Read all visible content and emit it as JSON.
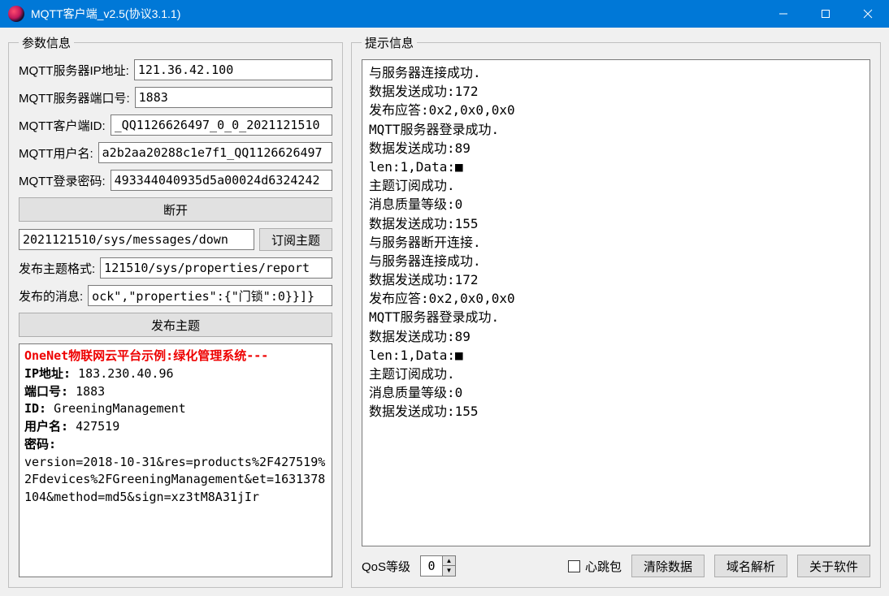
{
  "window": {
    "title": "MQTT客户端_v2.5(协议3.1.1)"
  },
  "left": {
    "legend": "参数信息",
    "server_ip_label": "MQTT服务器IP地址:",
    "server_ip": "121.36.42.100",
    "server_port_label": "MQTT服务器端口号:",
    "server_port": "1883",
    "client_id_label": "MQTT客户端ID:",
    "client_id": "_QQ1126626497_0_0_2021121510",
    "username_label": "MQTT用户名:",
    "username": "a2b2aa20288c1e7f1_QQ1126626497",
    "password_label": "MQTT登录密码:",
    "password": "493344040935d5a00024d6324242",
    "disconnect_btn": "断开",
    "sub_topic": "2021121510/sys/messages/down",
    "sub_btn": "订阅主题",
    "pub_topic_label": "发布主题格式:",
    "pub_topic": "121510/sys/properties/report",
    "pub_msg_label": "发布的消息:",
    "pub_msg": "ock\",\"properties\":{\"门锁\":0}}]}",
    "pub_btn": "发布主题",
    "example": {
      "title": "OneNet物联网云平台示例:绿化管理系统---",
      "ip_label": "IP地址:",
      "ip": "183.230.40.96",
      "port_label": "端口号:",
      "port": "1883",
      "id_label": "ID:",
      "id": "GreeningManagement",
      "user_label": "用户名:",
      "user": "427519",
      "pwd_label": "密码:",
      "pwd_body": "version=2018-10-31&res=products%2F427519%2Fdevices%2FGreeningManagement&et=1631378104&method=md5&sign=xz3tM8A31jIr"
    }
  },
  "right": {
    "legend": "提示信息",
    "log_lines": [
      "与服务器连接成功.",
      "数据发送成功:172",
      "发布应答:0x2,0x0,0x0",
      "MQTT服务器登录成功.",
      "数据发送成功:89",
      "len:1,Data:■",
      "主题订阅成功.",
      "消息质量等级:0",
      "数据发送成功:155",
      "与服务器断开连接.",
      "与服务器连接成功.",
      "数据发送成功:172",
      "发布应答:0x2,0x0,0x0",
      "MQTT服务器登录成功.",
      "数据发送成功:89",
      "len:1,Data:■",
      "主题订阅成功.",
      "消息质量等级:0",
      "数据发送成功:155"
    ],
    "qos_label": "QoS等级",
    "qos_value": "0",
    "heartbeat_label": "心跳包",
    "clear_btn": "清除数据",
    "dns_btn": "域名解析",
    "about_btn": "关于软件"
  }
}
